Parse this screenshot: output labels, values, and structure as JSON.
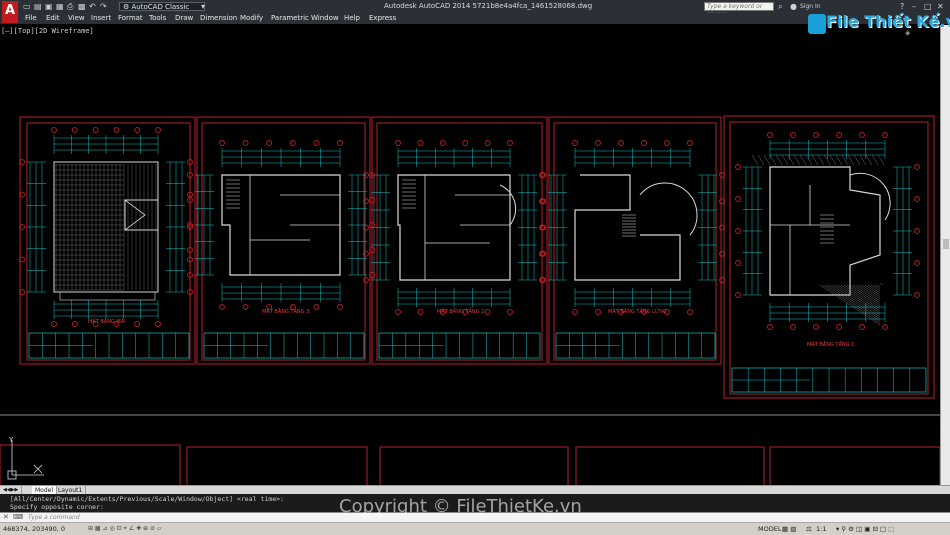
{
  "titlebar": {
    "workspace": "AutoCAD Classic",
    "window_title": "Autodesk AutoCAD 2014    5721b8e4a4fca_1461528068.dwg",
    "search_placeholder": "Type a keyword or phrase",
    "sign_in": "Sign In",
    "help": "?"
  },
  "menu": [
    "File",
    "Edit",
    "View",
    "Insert",
    "Format",
    "Tools",
    "Draw",
    "Dimension",
    "Modify",
    "Parametric",
    "Window",
    "Help",
    "Express"
  ],
  "logo": {
    "text": "File Thiết Kế.vn"
  },
  "viewport": {
    "label": "[–][Top][2D Wireframe]"
  },
  "plans": [
    {
      "label": "MẶT BẰNG MÁI"
    },
    {
      "label": "MẶT BẰNG TẦNG 3"
    },
    {
      "label": "MẶT BẰNG TẦNG 2"
    },
    {
      "label": "MẶT BẰNG TẦNG LỬNG"
    },
    {
      "label": "MẶT BẰNG TẦNG 1"
    }
  ],
  "tabs": {
    "model": "Model",
    "layout1": "Layout1"
  },
  "command": {
    "history1": "[All/Center/Dynamic/Extents/Previous/Scale/Window/Object] <real time>:",
    "history2": "Specify opposite corner:",
    "prompt": "Type a command"
  },
  "status": {
    "coords": "468374, 203490, 0",
    "model": "MODEL",
    "scale": "1:1"
  },
  "watermark": "Copyright © FileThietKe.vn",
  "colors": {
    "sheet_border": "#b5202a",
    "dim_line": "#18c3c3",
    "wall": "#d9d9d9",
    "marker": "#e02626"
  }
}
